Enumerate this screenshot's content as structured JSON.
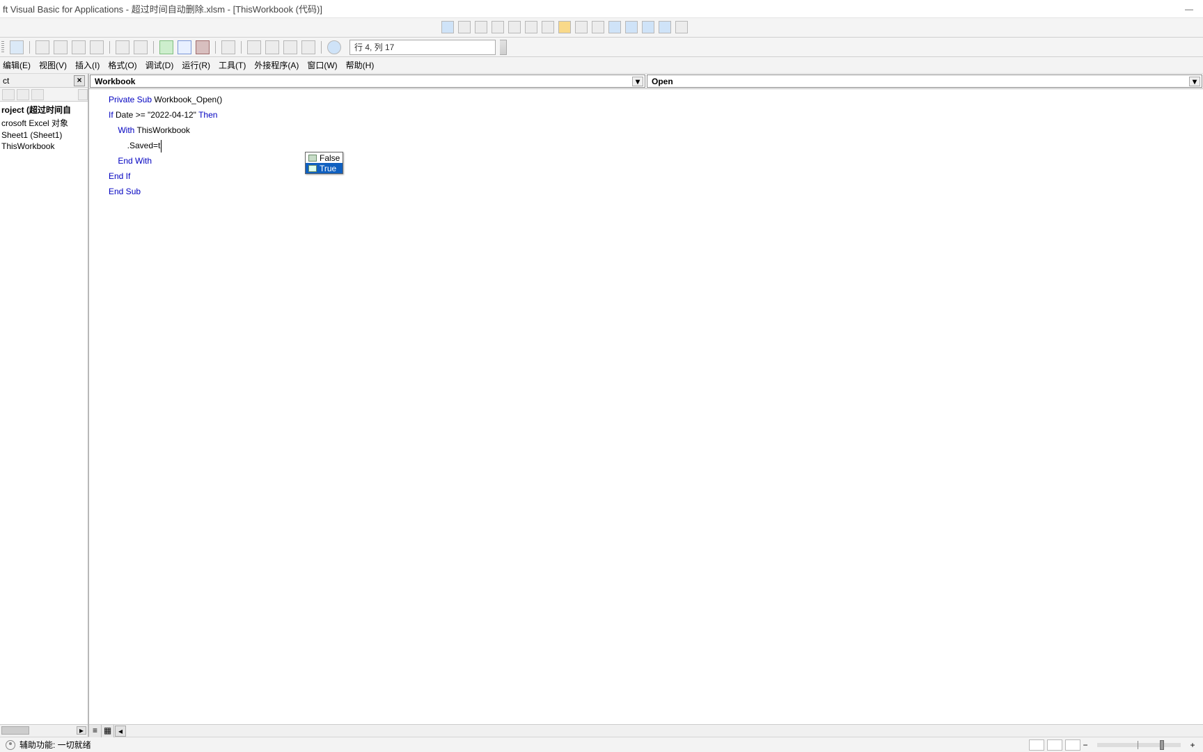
{
  "title": "ft Visual Basic for Applications - 超过时间自动删除.xlsm - [ThisWorkbook (代码)]",
  "menu": {
    "edit": "编辑(E)",
    "view": "视图(V)",
    "insert": "插入(I)",
    "format": "格式(O)",
    "debug": "调试(D)",
    "run": "运行(R)",
    "tools": "工具(T)",
    "addins": "外接程序(A)",
    "window": "窗口(W)",
    "help": "帮助(H)"
  },
  "cursor_status": "行 4, 列 17",
  "project_panel": {
    "title": "ct",
    "nodes": [
      "roject (超过时间自",
      "crosoft Excel 对象",
      "Sheet1 (Sheet1)",
      "ThisWorkbook"
    ]
  },
  "object_dd": "Workbook",
  "proc_dd": "Open",
  "code": {
    "l1_a": "Private Sub",
    "l1_b": " Workbook_Open()",
    "l2_a": "If",
    "l2_b": " Date >= \"2022-04-12\" ",
    "l2_c": "Then",
    "l3_a": "    ",
    "l3_b": "With",
    "l3_c": " ThisWorkbook",
    "l4": "        .Saved=t",
    "l5_a": "    ",
    "l5_b": "End With",
    "l6": "End If",
    "l7": "End Sub"
  },
  "intellisense": {
    "opt_false": "False",
    "opt_true": "True"
  },
  "status": {
    "acc": "辅助功能: 一切就绪"
  }
}
